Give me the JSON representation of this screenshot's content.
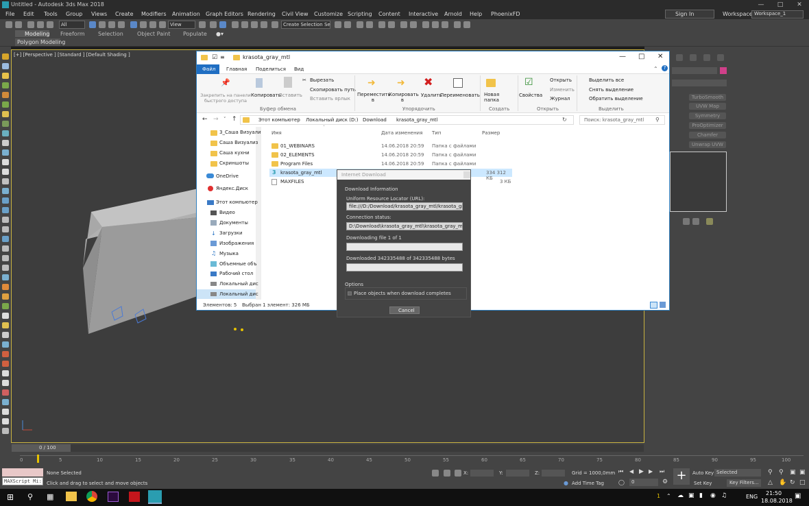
{
  "app": {
    "title": "Untitled - Autodesk 3ds Max 2018",
    "menu": [
      "File",
      "Edit",
      "Tools",
      "Group",
      "Views",
      "Create",
      "Modifiers",
      "Animation",
      "Graph Editors",
      "Rendering",
      "Civil View",
      "Customize",
      "Scripting",
      "Content",
      "Interactive",
      "Arnold",
      "Help",
      "PhoenixFD"
    ],
    "signin": "Sign In",
    "workspaces_label": "Workspaces:",
    "workspace_value": "Workspace_1",
    "toolbar": {
      "filter_all": "All",
      "view": "View",
      "create_selection_set": "Create Selection Se"
    },
    "ribbon_tabs": [
      "Modeling",
      "Freeform",
      "Selection",
      "Object Paint",
      "Populate"
    ],
    "ribbon_subtab": "Polygon Modeling",
    "viewport_label": "[+] [Perspective ] [Standard ] [Default Shading ]"
  },
  "right_panel": {
    "modifiers": [
      "TurboSmooth",
      "UVW Map",
      "Symmetry",
      "ProOptimizer",
      "Chamfer",
      "Unwrap UVW"
    ]
  },
  "timeline": {
    "frame_label": "0 / 100",
    "ticks": [
      "0",
      "5",
      "10",
      "15",
      "20",
      "25",
      "30",
      "35",
      "40",
      "45",
      "50",
      "55",
      "60",
      "65",
      "70",
      "75",
      "80",
      "85",
      "90",
      "95",
      "100"
    ]
  },
  "status": {
    "selection": "None Selected",
    "prompt": "Click and drag to select and move objects",
    "script_label": "MAXScript Mi:",
    "x_label": "X:",
    "y_label": "Y:",
    "z_label": "Z:",
    "grid": "Grid = 1000,0mm",
    "add_time_tag": "Add Time Tag",
    "auto_key": "Auto Key",
    "set_key": "Set Key",
    "selected": "Selected",
    "key_filters": "Key Filters...",
    "frame_field": "0"
  },
  "taskbar": {
    "lang": "ENG",
    "time": "21:50",
    "date": "18.08.2018",
    "badge": "1"
  },
  "explorer": {
    "title": "krasota_gray_mtl",
    "tabs": [
      "Файл",
      "Главная",
      "Поделиться",
      "Вид"
    ],
    "ribbon": {
      "pin": "Закрепить на панели быстрого доступа",
      "copy": "Копировать",
      "paste": "Вставить",
      "cut": "Вырезать",
      "copy_path": "Скопировать путь",
      "paste_shortcut": "Вставить ярлык",
      "group_clipboard": "Буфер обмена",
      "move_to": "Переместить в",
      "copy_to": "Копировать в",
      "delete": "Удалить",
      "rename": "Переименовать",
      "group_organize": "Упорядочить",
      "new_folder": "Новая папка",
      "group_create": "Создать",
      "properties": "Свойства",
      "open": "Открыть",
      "edit": "Изменить",
      "history": "Журнал",
      "group_open": "Открыть",
      "select_all": "Выделить все",
      "select_none": "Снять выделение",
      "invert_selection": "Обратить выделение",
      "group_select": "Выделить"
    },
    "breadcrumb": [
      "Этот компьютер",
      "Локальный диск (D:)",
      "Download",
      "krasota_gray_mtl"
    ],
    "search_placeholder": "Поиск: krasota_gray_mtl",
    "nav": [
      "3_Саша Визуали",
      "Саша Визуализ",
      "Саша кухни",
      "Скриншоты",
      "OneDrive",
      "Яндекс.Диск",
      "Этот компьютер",
      "Видео",
      "Документы",
      "Загрузки",
      "Изображения",
      "Музыка",
      "Объемные объ",
      "Рабочий стол",
      "Локальный дис",
      "Локальный дис"
    ],
    "columns": [
      "Имя",
      "Дата изменения",
      "Тип",
      "Размер"
    ],
    "files": [
      {
        "name": "01_WEBINARS",
        "date": "14.06.2018 20:59",
        "type": "Папка с файлами",
        "size": ""
      },
      {
        "name": "02_ELEMENTS",
        "date": "14.06.2018 20:59",
        "type": "Папка с файлами",
        "size": ""
      },
      {
        "name": "Program Files",
        "date": "14.06.2018 20:59",
        "type": "Папка с файлами",
        "size": ""
      },
      {
        "name": "krasota_gray_mtl",
        "date": "",
        "type": "",
        "size": "334 312 КБ"
      },
      {
        "name": "MAXFILES",
        "date": "",
        "type": "",
        "size": "3 КБ"
      }
    ],
    "status_items": "Элементов: 5",
    "status_selected": "Выбран 1 элемент: 326 МБ"
  },
  "dialog": {
    "title": "Internet Download",
    "section_info": "Download Information",
    "url_label": "Uniform Resource Locator (URL):",
    "url_value": "file:///D:/Download/krasota_gray_mtl/krasota_gray_mtl",
    "conn_label": "Connection status:",
    "conn_value": "D:\\Download\\krasota_gray_mtl\\krasota_gray_mtl.max",
    "downloading": "Downloading file 1 of 1",
    "downloaded": "Downloaded 342335488 of 342335488 bytes",
    "options": "Options",
    "place_objects": "Place objects when download completes",
    "cancel": "Cancel"
  }
}
